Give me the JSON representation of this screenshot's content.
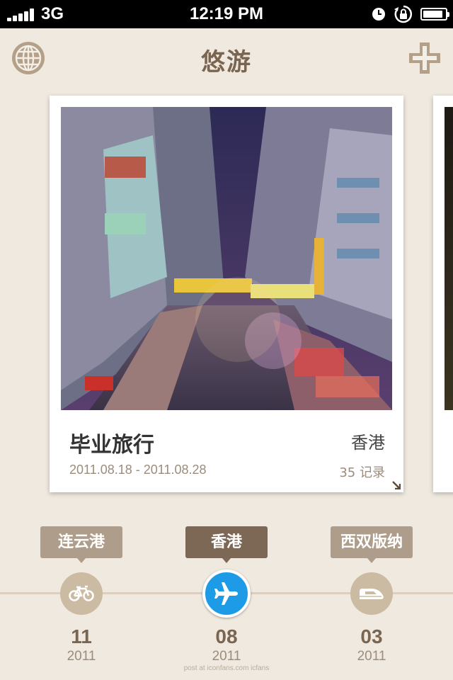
{
  "status": {
    "network": "3G",
    "time": "12:19 PM",
    "battery_level": 0.9
  },
  "header": {
    "title": "悠游",
    "left_icon": "globe-icon",
    "right_icon": "plus-icon"
  },
  "card": {
    "name": "毕业旅行",
    "place": "香港",
    "dates": "2011.08.18 - 2011.08.28",
    "count": "35 记录"
  },
  "timeline": [
    {
      "place": "连云港",
      "day": "11",
      "year": "2011",
      "icon": "bicycle-icon",
      "active": false
    },
    {
      "place": "香港",
      "day": "08",
      "year": "2011",
      "icon": "airplane-icon",
      "active": true
    },
    {
      "place": "西双版纳",
      "day": "03",
      "year": "2011",
      "icon": "train-icon",
      "active": false
    }
  ],
  "watermark": "post at iconfans.com  icfans",
  "colors": {
    "accent": "#1d9be6",
    "brown": "#7c6855",
    "tag": "#ad9d8a",
    "background": "#efe9df"
  }
}
